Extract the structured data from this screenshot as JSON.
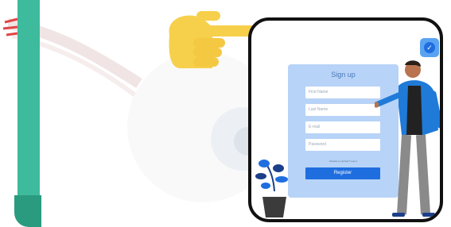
{
  "form": {
    "title": "Sign up",
    "first_name_placeholder": "First Name",
    "last_name_placeholder": "Last Name",
    "email_placeholder": "E-mail",
    "password_placeholder": "Password",
    "login_hint": "Already a member? Log in",
    "register_label": "Register"
  },
  "icons": {
    "check": "✓"
  },
  "colors": {
    "green_bar": "#3dbb9c",
    "hand": "#f7d04b",
    "form_card": "#b7d3f7",
    "register_button": "#1f6ee0",
    "person_jacket": "#1f7ad8"
  }
}
